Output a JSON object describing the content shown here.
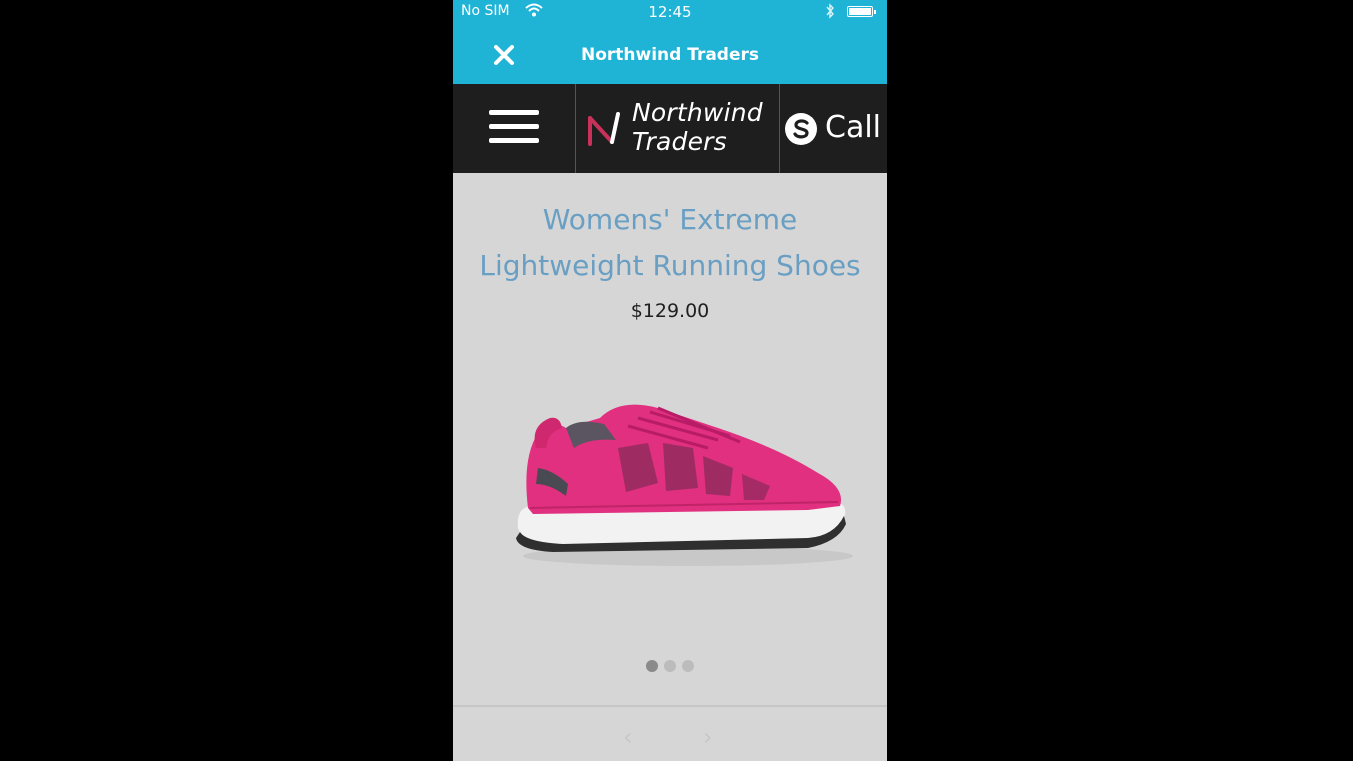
{
  "status_bar": {
    "carrier": "No SIM",
    "time": "12:45"
  },
  "title_bar": {
    "title": "Northwind Traders"
  },
  "header": {
    "logo_line1": "Northwind",
    "logo_line2": "Traders",
    "call_label": "Call"
  },
  "product": {
    "title": "Womens' Extreme Lightweight Running Shoes",
    "price": "$129.00",
    "image_count": 3,
    "active_image_index": 0
  },
  "colors": {
    "title_bar_bg": "#1fb3d6",
    "header_bg": "#1e1e1e",
    "product_title": "#6a9fc4",
    "shoe_pink": "#e0307f"
  },
  "icons": [
    "wifi-icon",
    "bluetooth-icon",
    "battery-icon",
    "close-icon",
    "hamburger-menu-icon",
    "northwind-logo-icon",
    "skype-icon",
    "chevron-left-icon",
    "chevron-right-icon"
  ]
}
